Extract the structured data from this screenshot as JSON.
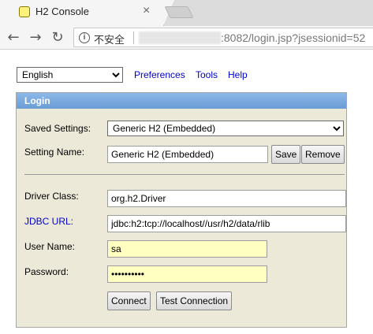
{
  "browser": {
    "tab_title": "H2 Console",
    "tab_close": "×",
    "nav": {
      "back": "←",
      "forward": "→",
      "reload": "↻"
    },
    "info_icon": "i",
    "security_label": "不安全",
    "url_visible": ":8082/login.jsp?jsessionid=52"
  },
  "header": {
    "language_selected": "English",
    "links": [
      "Preferences",
      "Tools",
      "Help"
    ]
  },
  "login": {
    "title": "Login",
    "saved_settings_label": "Saved Settings:",
    "saved_settings_value": "Generic H2 (Embedded)",
    "setting_name_label": "Setting Name:",
    "setting_name_value": "Generic H2 (Embedded)",
    "save_label": "Save",
    "remove_label": "Remove",
    "driver_class_label": "Driver Class:",
    "driver_class_value": "org.h2.Driver",
    "jdbc_url_label": "JDBC URL:",
    "jdbc_url_value": "jdbc:h2:tcp://localhost//usr/h2/data/rlib",
    "user_name_label": "User Name:",
    "user_name_value": "sa",
    "password_label": "Password:",
    "password_value": "••••••••••",
    "connect_label": "Connect",
    "test_connection_label": "Test Connection"
  },
  "colors": {
    "panel_bg": "#ece9d8",
    "header_blue": "#7aaae0",
    "link_blue": "#0000cc",
    "autofill_yellow": "#ffffc0"
  }
}
